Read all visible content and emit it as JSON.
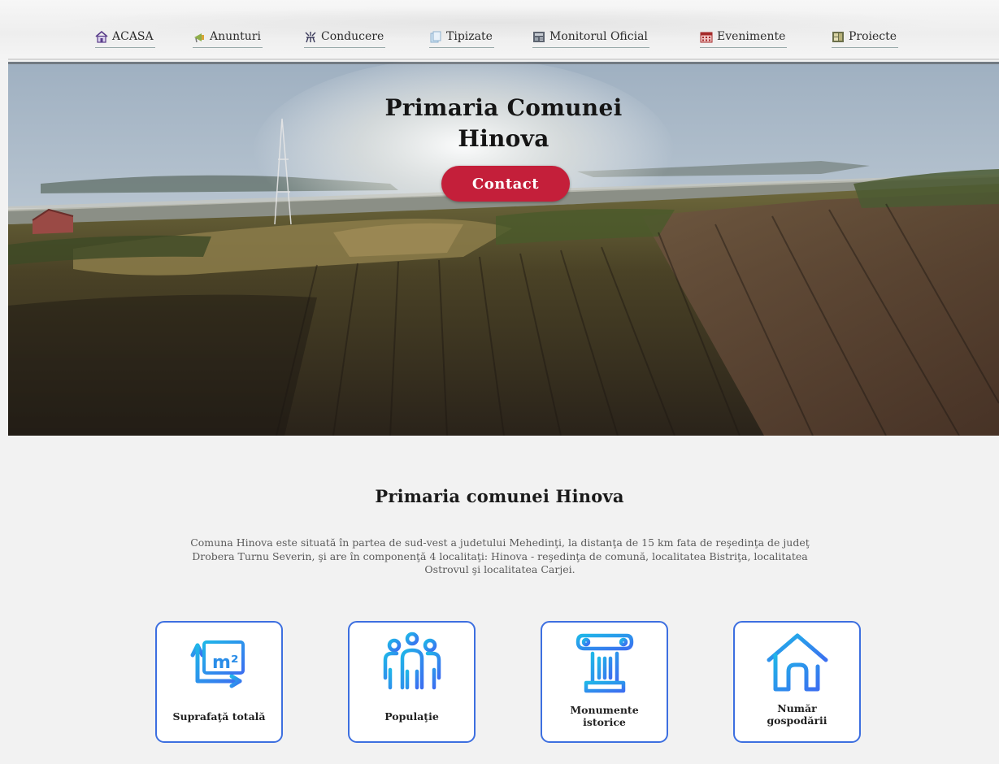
{
  "nav": {
    "items": [
      {
        "label": "ACASA",
        "icon": "home-icon"
      },
      {
        "label": "Anunturi",
        "icon": "megaphone-icon"
      },
      {
        "label": "Conducere",
        "icon": "leadership-icon"
      },
      {
        "label": "Tipizate",
        "icon": "documents-icon"
      },
      {
        "label": "Monitorul Oficial",
        "icon": "monitor-icon"
      },
      {
        "label": "Evenimente",
        "icon": "calendar-icon"
      },
      {
        "label": "Proiecte",
        "icon": "projects-icon"
      }
    ]
  },
  "hero": {
    "title_line1": "Primaria Comunei",
    "title_line2": "Hinova",
    "button": "Contact"
  },
  "about": {
    "title": "Primaria comunei Hinova",
    "description": "Comuna Hinova este situată în partea de sud-vest a judetului Mehedinţi, la distanţa de 15 km fata de reşedinţa de judeţ Drobera Turnu Severin, şi are în componenţă 4 localitaţi: Hinova -  reşedinţa de comună, localitatea Bistriţa, localitatea Ostrovul şi localitatea Carjei."
  },
  "cards": [
    {
      "label": "Suprafaţă totală",
      "icon": "area-m2-icon"
    },
    {
      "label": "Populaţie",
      "icon": "population-icon"
    },
    {
      "label": "Monumente istorice",
      "label_line1": "Monumente",
      "label_line2": "istorice",
      "icon": "column-monument-icon"
    },
    {
      "label": "Număr gospodării",
      "label_line1": "Număr",
      "label_line2": "gospodării",
      "icon": "house-icon"
    }
  ],
  "colors": {
    "accent_button": "#c41f3a",
    "card_border": "#3d6fe0",
    "icon_gradient_start": "#1fb6e8",
    "icon_gradient_end": "#3b6ff0"
  }
}
